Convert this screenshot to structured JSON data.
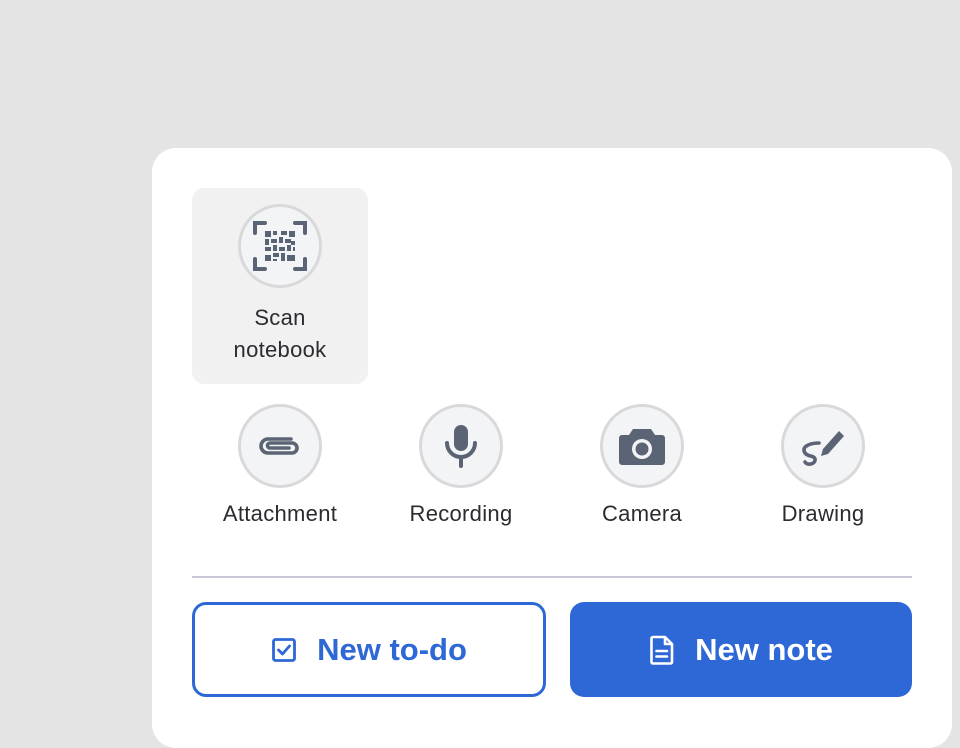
{
  "sheet": {
    "scan": {
      "label": "Scan notebook",
      "icon": "qr-scan-icon"
    },
    "actions": [
      {
        "label": "Attachment",
        "icon": "paperclip-icon"
      },
      {
        "label": "Recording",
        "icon": "microphone-icon"
      },
      {
        "label": "Camera",
        "icon": "camera-icon"
      },
      {
        "label": "Drawing",
        "icon": "pen-scribble-icon"
      }
    ],
    "buttons": {
      "new_todo": {
        "label": "New to-do",
        "icon": "checkbox-icon"
      },
      "new_note": {
        "label": "New note",
        "icon": "document-icon"
      }
    }
  },
  "colors": {
    "accent": "#2e67d6",
    "icon": "#5b6474",
    "backdrop": "#e4e4e4"
  }
}
